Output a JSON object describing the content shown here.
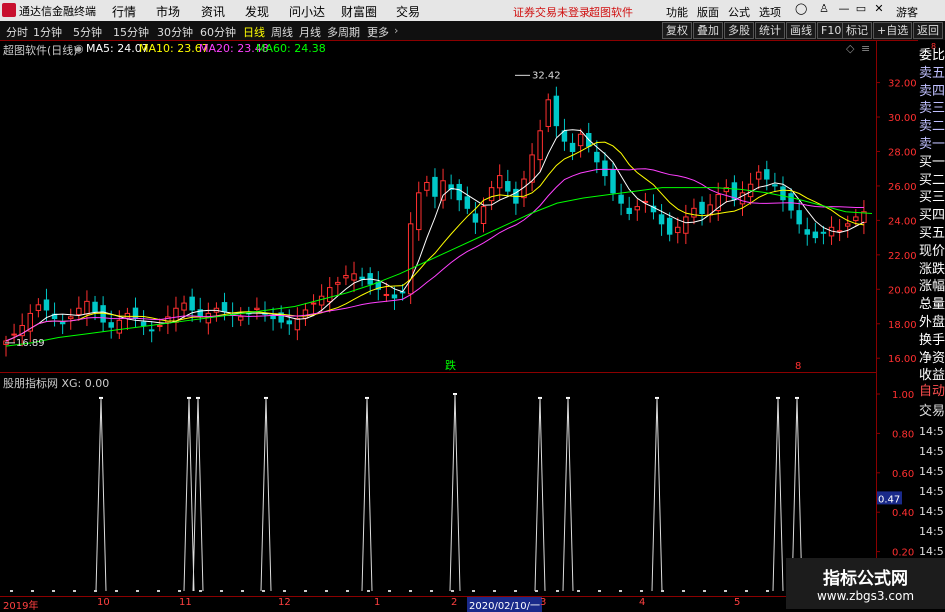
{
  "menubar": {
    "app_title": "通达信金融终端",
    "menus": [
      "行情",
      "市场",
      "资讯",
      "发现",
      "问小达",
      "财富圈",
      "交易"
    ],
    "notice_login": "证券交易未登录",
    "notice_brand": "超图软件",
    "right_menus": [
      "功能",
      "版面",
      "公式",
      "选项"
    ],
    "guest": "游客"
  },
  "toolbar": {
    "periods": [
      "分时",
      "1分钟",
      "5分钟",
      "15分钟",
      "30分钟",
      "60分钟",
      "日线",
      "周线",
      "月线",
      "多周期",
      "更多"
    ],
    "active_period": "日线",
    "right_buttons": [
      "复权",
      "叠加",
      "多股",
      "统计",
      "画线",
      "F10",
      "标记",
      "+自选",
      "返回"
    ]
  },
  "header": {
    "stock": "超图软件(日线)",
    "ma5": "MA5: 24.07",
    "ma10": "MA10: 23.67",
    "ma20": "MA20: 23.48",
    "ma60": "MA60: 24.38"
  },
  "colors": {
    "up": "#ff3030",
    "down": "#00c8c8",
    "ma5": "#ffffff",
    "ma10": "#ffff00",
    "ma20": "#ff40ff",
    "ma60": "#00ff00",
    "border": "#8b0000"
  },
  "right_panel": {
    "top_items": [
      "委比",
      "卖五",
      "卖四",
      "卖三",
      "卖二",
      "卖一",
      "买一",
      "买二",
      "买三",
      "买四",
      "买五",
      "现价",
      "涨跌",
      "涨幅",
      "总量",
      "外盘",
      "换手",
      "净资",
      "收益"
    ],
    "bottom_items": [
      "自动",
      "交易",
      "14:5",
      "14:5",
      "14:5",
      "14:5",
      "14:5",
      "14:5",
      "14:5",
      "14:5"
    ]
  },
  "price_axis": [
    "32.00",
    "30.00",
    "28.00",
    "26.00",
    "24.00",
    "22.00",
    "20.00",
    "18.00",
    "16.00"
  ],
  "annotations": {
    "high": "32.42",
    "low": "16.89",
    "mark_die": "跌",
    "mark_8": "8"
  },
  "indicator": {
    "title": "股朋指标网 XG: 0.00",
    "axis": [
      "1.00",
      "0.80",
      "0.60",
      "0.40",
      "0.20"
    ],
    "cursor_value": "0.47",
    "auto_label": "自动"
  },
  "xaxis": {
    "labels": [
      "2019年",
      "10",
      "11",
      "12",
      "1",
      "2",
      "3",
      "4",
      "5"
    ],
    "cursor_date": "2020/02/10/一"
  },
  "watermark": {
    "line1": "指标公式网",
    "line2": "www.zbgs3.com"
  },
  "chart_data": {
    "type": "candlestick+line",
    "price_range": [
      15.2,
      33.6
    ],
    "close_series": [
      17.0,
      17.4,
      17.9,
      18.6,
      19.1,
      18.8,
      18.3,
      18.0,
      18.4,
      18.9,
      19.3,
      18.7,
      18.1,
      17.8,
      18.2,
      18.6,
      18.3,
      17.9,
      17.6,
      17.9,
      18.4,
      18.9,
      19.2,
      18.8,
      18.4,
      18.6,
      18.9,
      18.7,
      18.5,
      18.4,
      18.6,
      18.9,
      18.6,
      18.3,
      18.1,
      18.0,
      18.3,
      18.8,
      19.2,
      19.6,
      20.1,
      20.4,
      20.8,
      20.9,
      20.6,
      20.3,
      20.0,
      19.7,
      19.5,
      19.8,
      23.8,
      25.6,
      26.2,
      25.4,
      26.3,
      25.8,
      25.2,
      24.7,
      23.9,
      24.8,
      25.9,
      26.6,
      25.7,
      25.0,
      26.4,
      27.8,
      29.2,
      31.0,
      29.5,
      28.6,
      28.0,
      29.0,
      28.3,
      27.4,
      26.6,
      25.6,
      25.0,
      24.4,
      24.8,
      25.1,
      24.5,
      23.8,
      23.2,
      23.6,
      24.2,
      24.7,
      24.4,
      24.9,
      25.5,
      25.9,
      25.2,
      25.6,
      26.1,
      26.8,
      26.4,
      26.0,
      25.2,
      24.6,
      23.8,
      23.2,
      23.0,
      23.3,
      23.6,
      23.4,
      23.8,
      24.2,
      24.5
    ],
    "ma60_series": [
      16.7,
      16.9,
      17.2,
      17.4,
      17.6,
      17.8,
      18.0,
      18.2,
      18.4,
      18.6,
      18.8,
      19.0,
      19.4,
      19.8,
      20.3,
      20.9,
      21.6,
      22.3,
      23.0,
      23.7,
      24.4,
      25.0,
      25.3,
      25.5,
      25.7,
      25.9,
      25.9,
      25.9,
      25.8,
      25.6,
      25.3,
      24.9,
      24.5,
      24.4
    ],
    "xg_spikes": [
      0.98,
      0.98,
      0.98,
      0.98,
      0.98,
      1.0,
      0.98,
      0.98,
      0.98,
      0.98,
      0.98
    ]
  }
}
